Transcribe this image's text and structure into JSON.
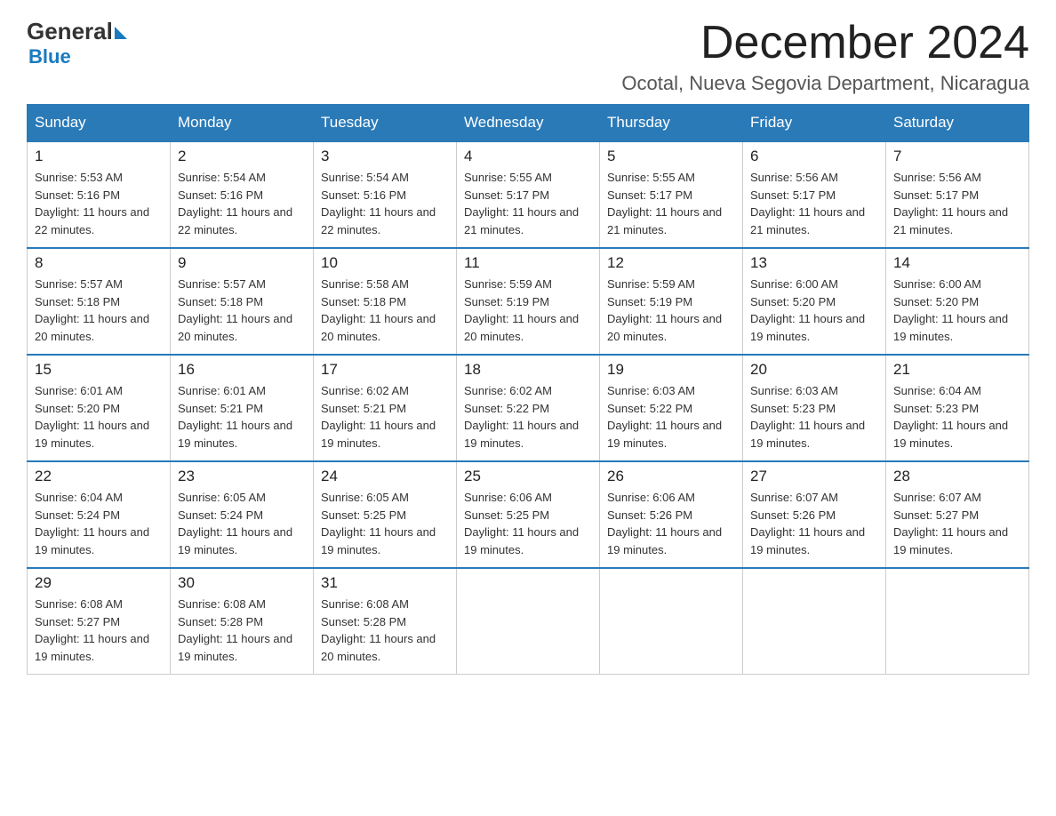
{
  "header": {
    "logo_general": "General",
    "logo_blue": "Blue",
    "month_title": "December 2024",
    "location": "Ocotal, Nueva Segovia Department, Nicaragua"
  },
  "weekdays": [
    "Sunday",
    "Monday",
    "Tuesday",
    "Wednesday",
    "Thursday",
    "Friday",
    "Saturday"
  ],
  "weeks": [
    [
      {
        "day": "1",
        "sunrise": "5:53 AM",
        "sunset": "5:16 PM",
        "daylight": "11 hours and 22 minutes."
      },
      {
        "day": "2",
        "sunrise": "5:54 AM",
        "sunset": "5:16 PM",
        "daylight": "11 hours and 22 minutes."
      },
      {
        "day": "3",
        "sunrise": "5:54 AM",
        "sunset": "5:16 PM",
        "daylight": "11 hours and 22 minutes."
      },
      {
        "day": "4",
        "sunrise": "5:55 AM",
        "sunset": "5:17 PM",
        "daylight": "11 hours and 21 minutes."
      },
      {
        "day": "5",
        "sunrise": "5:55 AM",
        "sunset": "5:17 PM",
        "daylight": "11 hours and 21 minutes."
      },
      {
        "day": "6",
        "sunrise": "5:56 AM",
        "sunset": "5:17 PM",
        "daylight": "11 hours and 21 minutes."
      },
      {
        "day": "7",
        "sunrise": "5:56 AM",
        "sunset": "5:17 PM",
        "daylight": "11 hours and 21 minutes."
      }
    ],
    [
      {
        "day": "8",
        "sunrise": "5:57 AM",
        "sunset": "5:18 PM",
        "daylight": "11 hours and 20 minutes."
      },
      {
        "day": "9",
        "sunrise": "5:57 AM",
        "sunset": "5:18 PM",
        "daylight": "11 hours and 20 minutes."
      },
      {
        "day": "10",
        "sunrise": "5:58 AM",
        "sunset": "5:18 PM",
        "daylight": "11 hours and 20 minutes."
      },
      {
        "day": "11",
        "sunrise": "5:59 AM",
        "sunset": "5:19 PM",
        "daylight": "11 hours and 20 minutes."
      },
      {
        "day": "12",
        "sunrise": "5:59 AM",
        "sunset": "5:19 PM",
        "daylight": "11 hours and 20 minutes."
      },
      {
        "day": "13",
        "sunrise": "6:00 AM",
        "sunset": "5:20 PM",
        "daylight": "11 hours and 19 minutes."
      },
      {
        "day": "14",
        "sunrise": "6:00 AM",
        "sunset": "5:20 PM",
        "daylight": "11 hours and 19 minutes."
      }
    ],
    [
      {
        "day": "15",
        "sunrise": "6:01 AM",
        "sunset": "5:20 PM",
        "daylight": "11 hours and 19 minutes."
      },
      {
        "day": "16",
        "sunrise": "6:01 AM",
        "sunset": "5:21 PM",
        "daylight": "11 hours and 19 minutes."
      },
      {
        "day": "17",
        "sunrise": "6:02 AM",
        "sunset": "5:21 PM",
        "daylight": "11 hours and 19 minutes."
      },
      {
        "day": "18",
        "sunrise": "6:02 AM",
        "sunset": "5:22 PM",
        "daylight": "11 hours and 19 minutes."
      },
      {
        "day": "19",
        "sunrise": "6:03 AM",
        "sunset": "5:22 PM",
        "daylight": "11 hours and 19 minutes."
      },
      {
        "day": "20",
        "sunrise": "6:03 AM",
        "sunset": "5:23 PM",
        "daylight": "11 hours and 19 minutes."
      },
      {
        "day": "21",
        "sunrise": "6:04 AM",
        "sunset": "5:23 PM",
        "daylight": "11 hours and 19 minutes."
      }
    ],
    [
      {
        "day": "22",
        "sunrise": "6:04 AM",
        "sunset": "5:24 PM",
        "daylight": "11 hours and 19 minutes."
      },
      {
        "day": "23",
        "sunrise": "6:05 AM",
        "sunset": "5:24 PM",
        "daylight": "11 hours and 19 minutes."
      },
      {
        "day": "24",
        "sunrise": "6:05 AM",
        "sunset": "5:25 PM",
        "daylight": "11 hours and 19 minutes."
      },
      {
        "day": "25",
        "sunrise": "6:06 AM",
        "sunset": "5:25 PM",
        "daylight": "11 hours and 19 minutes."
      },
      {
        "day": "26",
        "sunrise": "6:06 AM",
        "sunset": "5:26 PM",
        "daylight": "11 hours and 19 minutes."
      },
      {
        "day": "27",
        "sunrise": "6:07 AM",
        "sunset": "5:26 PM",
        "daylight": "11 hours and 19 minutes."
      },
      {
        "day": "28",
        "sunrise": "6:07 AM",
        "sunset": "5:27 PM",
        "daylight": "11 hours and 19 minutes."
      }
    ],
    [
      {
        "day": "29",
        "sunrise": "6:08 AM",
        "sunset": "5:27 PM",
        "daylight": "11 hours and 19 minutes."
      },
      {
        "day": "30",
        "sunrise": "6:08 AM",
        "sunset": "5:28 PM",
        "daylight": "11 hours and 19 minutes."
      },
      {
        "day": "31",
        "sunrise": "6:08 AM",
        "sunset": "5:28 PM",
        "daylight": "11 hours and 20 minutes."
      },
      null,
      null,
      null,
      null
    ]
  ],
  "labels": {
    "sunrise": "Sunrise:",
    "sunset": "Sunset:",
    "daylight": "Daylight:"
  }
}
